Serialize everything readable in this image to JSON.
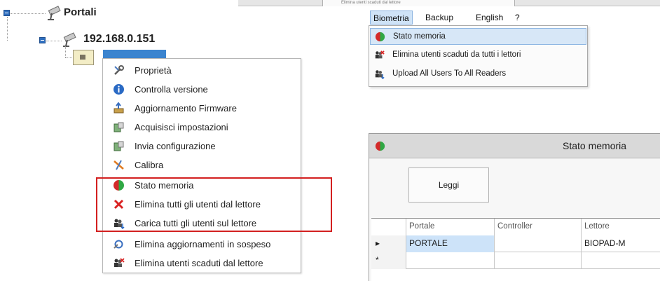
{
  "top_strip": {
    "faded_item": "Elimina utenti scaduti dal lettore"
  },
  "tree": {
    "root_label": "Portali",
    "controller_label": "192.168.0.151"
  },
  "context_menu": {
    "items": [
      {
        "label": "Proprietà",
        "icon": "tools-icon"
      },
      {
        "label": "Controlla versione",
        "icon": "info-icon"
      },
      {
        "label": "Aggiornamento Firmware",
        "icon": "firmware-icon"
      },
      {
        "label": "Acquisisci impostazioni",
        "icon": "acquire-settings-icon"
      },
      {
        "label": "Invia configurazione",
        "icon": "send-config-icon"
      },
      {
        "label": "Calibra",
        "icon": "calibrate-icon"
      },
      {
        "label": "Stato memoria",
        "icon": "memory-status-icon"
      },
      {
        "label": "Elimina tutti gli utenti dal lettore",
        "icon": "delete-users-icon"
      },
      {
        "label": "Carica tutti gli utenti sul lettore",
        "icon": "upload-users-icon"
      },
      {
        "label": "Elimina aggiornamenti in sospeso",
        "icon": "pending-updates-icon"
      },
      {
        "label": "Elimina utenti scaduti dal lettore",
        "icon": "expired-users-icon"
      }
    ]
  },
  "menubar": {
    "items": [
      {
        "label": "Biometria"
      },
      {
        "label": "Backup"
      },
      {
        "label": "English"
      },
      {
        "label": "?"
      }
    ]
  },
  "biometria_menu": {
    "items": [
      {
        "label": "Stato memoria",
        "icon": "memory-status-icon"
      },
      {
        "label": "Elimina utenti scaduti da tutti i lettori",
        "icon": "expired-users-icon"
      },
      {
        "label": "Upload All Users To All Readers",
        "icon": "upload-users-icon"
      }
    ]
  },
  "stato_window": {
    "title": "Stato memoria",
    "leggi_label": "Leggi",
    "columns": [
      "Portale",
      "Controller",
      "Lettore"
    ],
    "rows": [
      {
        "marker": "▸",
        "portale": "PORTALE",
        "controller": "",
        "lettore": "BIOPAD-M"
      },
      {
        "marker": "*",
        "portale": "",
        "controller": "",
        "lettore": ""
      }
    ]
  },
  "colors": {
    "highlight_border": "#d32020",
    "menu_hover": "#d7e7f7",
    "selection": "#3b84cf"
  }
}
